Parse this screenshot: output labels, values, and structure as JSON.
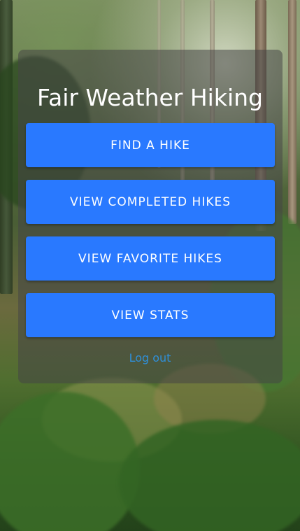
{
  "app": {
    "title": "Fair Weather Hiking"
  },
  "menu": {
    "find_hike": "FIND A HIKE",
    "completed_hikes": "VIEW COMPLETED HIKES",
    "favorite_hikes": "VIEW FAVORITE HIKES",
    "stats": "VIEW STATS"
  },
  "footer": {
    "logout_label": "Log out"
  },
  "colors": {
    "button_primary": "#2979ff",
    "link": "#2f8fd8",
    "panel_overlay": "rgba(70,70,70,0.55)"
  },
  "background": {
    "image_semantic": "forest-background"
  }
}
